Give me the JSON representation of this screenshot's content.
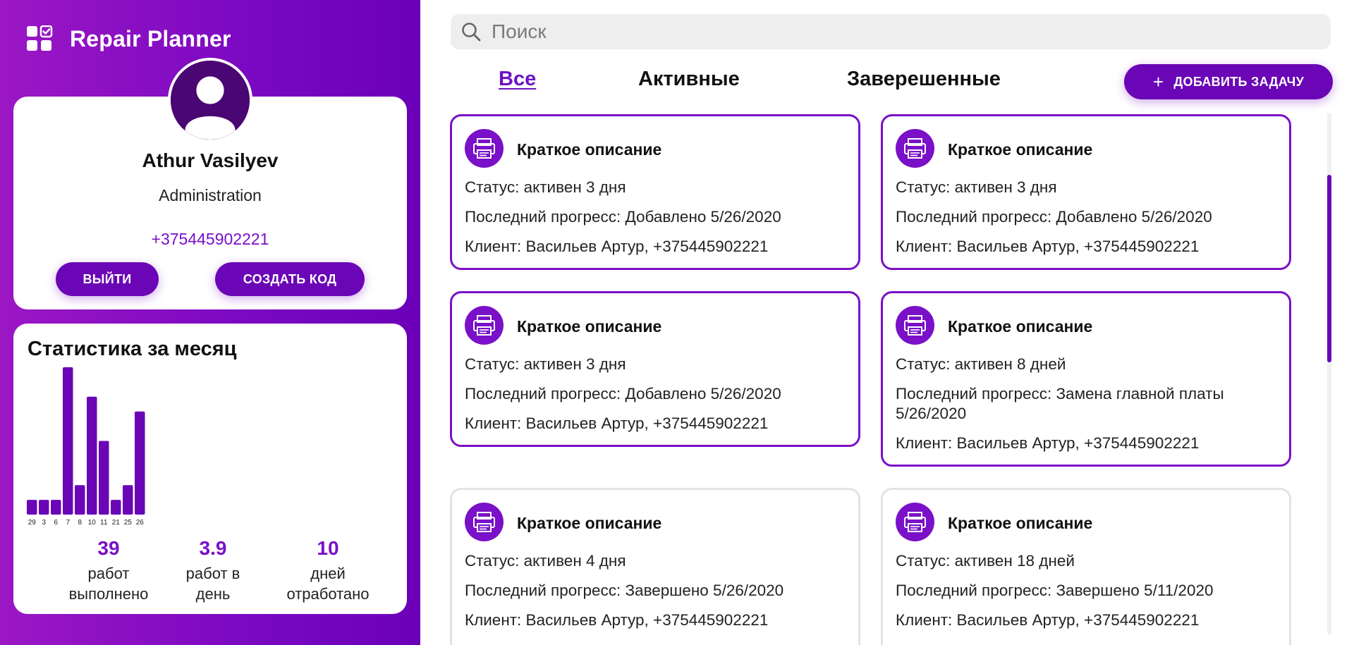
{
  "app": {
    "title": "Repair Planner"
  },
  "profile": {
    "name": "Athur Vasilyev",
    "role": "Administration",
    "phone": "+375445902221",
    "logout_label": "ВЫЙТИ",
    "create_code_label": "СОЗДАТЬ КОД"
  },
  "stats": {
    "title": "Статистика за месяц",
    "summary": [
      {
        "value": "39",
        "label_line1": "работ",
        "label_line2": "выполнено"
      },
      {
        "value": "3.9",
        "label_line1": "работ в",
        "label_line2": "день"
      },
      {
        "value": "10",
        "label_line1": "дней",
        "label_line2": "отработано"
      }
    ]
  },
  "chart_data": {
    "type": "bar",
    "categories": [
      "29",
      "3",
      "6",
      "7",
      "8",
      "10",
      "11",
      "21",
      "25",
      "26"
    ],
    "values": [
      1,
      1,
      1,
      10,
      2,
      8,
      5,
      1,
      2,
      7
    ],
    "ylim": [
      0,
      10
    ],
    "title": "",
    "xlabel": "",
    "ylabel": "",
    "grid": false,
    "color": "#6a06b6"
  },
  "search": {
    "placeholder": "Поиск"
  },
  "tabs": {
    "all": "Все",
    "active": "Активные",
    "done": "Заверешенные"
  },
  "add_task": {
    "label": "ДОБАВИТЬ ЗАДАЧУ"
  },
  "tasks": [
    {
      "title": "Краткое описание",
      "status": "Статус: активен 3 дня",
      "progress": "Последний прогресс: Добавлено 5/26/2020",
      "client": "Клиент: Васильев Артур, +375445902221"
    },
    {
      "title": "Краткое описание",
      "status": "Статус: активен 3 дня",
      "progress": "Последний прогресс: Добавлено 5/26/2020",
      "client": "Клиент: Васильев Артур, +375445902221"
    },
    {
      "title": "Краткое описание",
      "status": "Статус: активен 3 дня",
      "progress": "Последний прогресс: Добавлено 5/26/2020",
      "client": "Клиент: Васильев Артур, +375445902221"
    },
    {
      "title": "Краткое описание",
      "status": "Статус: активен 8 дней",
      "progress": "Последний прогресс: Замена главной платы 5/26/2020",
      "client": "Клиент: Васильев Артур, +375445902221"
    },
    {
      "title": "Краткое описание",
      "status": "Статус: активен 4 дня",
      "progress": "Последний прогресс: Завершено 5/26/2020",
      "client": "Клиент: Васильев Артур, +375445902221"
    },
    {
      "title": "Краткое описание",
      "status": "Статус: активен 18 дней",
      "progress": "Последний прогресс: Завершено 5/11/2020",
      "client": "Клиент: Васильев Артур, +375445902221"
    }
  ],
  "colors": {
    "accent": "#6a06b6",
    "accent_text": "#7a10c8",
    "sidebar_gradient_start": "#9b17c4",
    "sidebar_gradient_end": "#6b00b8",
    "done_border": "#e3e3e3"
  },
  "icons": {
    "logo": "dashboard-grid-check-icon",
    "avatar": "user-avatar-icon",
    "search": "search-icon",
    "add": "plus-icon",
    "task": "printer-icon"
  }
}
